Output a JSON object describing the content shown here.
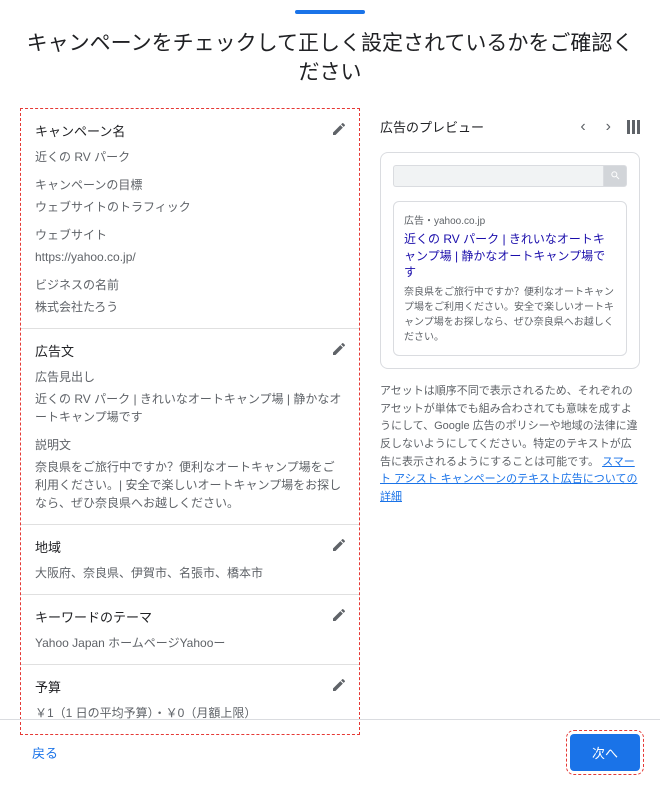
{
  "page": {
    "title": "キャンペーンをチェックして正しく設定されているかをご確認ください"
  },
  "sections": {
    "campaign_name": {
      "label": "キャンペーン名",
      "value": "近くの RV パーク"
    },
    "campaign_goal": {
      "label": "キャンペーンの目標",
      "value": "ウェブサイトのトラフィック"
    },
    "website": {
      "label": "ウェブサイト",
      "value": "https://yahoo.co.jp/"
    },
    "business_name": {
      "label": "ビジネスの名前",
      "value": "株式会社たろう"
    },
    "ad_copy": {
      "header": "広告文",
      "headline_label": "広告見出し",
      "headline_value": "近くの RV パーク | きれいなオートキャンプ場 | 静かなオートキャンプ場です",
      "desc_label": "説明文",
      "desc_value": "奈良県をご旅行中ですか？便利なオートキャンプ場をご利用ください。| 安全で楽しいオートキャンプ場をお探しなら、ぜひ奈良県へお越しください。"
    },
    "region": {
      "label": "地域",
      "value": "大阪府、奈良県、伊賀市、名張市、橋本市"
    },
    "keywords": {
      "label": "キーワードのテーマ",
      "value": "Yahoo Japan ホームページYahooー"
    },
    "budget": {
      "label": "予算",
      "value": "￥1（1 日の平均予算）・￥0（月額上限）"
    }
  },
  "preview": {
    "title": "広告のプレビュー",
    "ad_label": "広告・yahoo.co.jp",
    "ad_headline": "近くの RV パーク | きれいなオートキャンプ場 | 静かなオートキャンプ場です",
    "ad_desc": "奈良県をご旅行中ですか？便利なオートキャンプ場をご利用ください。安全で楽しいオートキャンプ場をお探しなら、ぜひ奈良県へお越しください。"
  },
  "disclaimer": {
    "text": "アセットは順序不同で表示されるため、それぞれのアセットが単体でも組み合わされても意味を成すようにして、Google 広告のポリシーや地域の法律に違反しないようにしてください。特定のテキストが広告に表示されるようにすることは可能です。",
    "link_text": "スマート アシスト キャンペーンのテキスト広告についての詳細"
  },
  "footer": {
    "back": "戻る",
    "next": "次へ"
  }
}
